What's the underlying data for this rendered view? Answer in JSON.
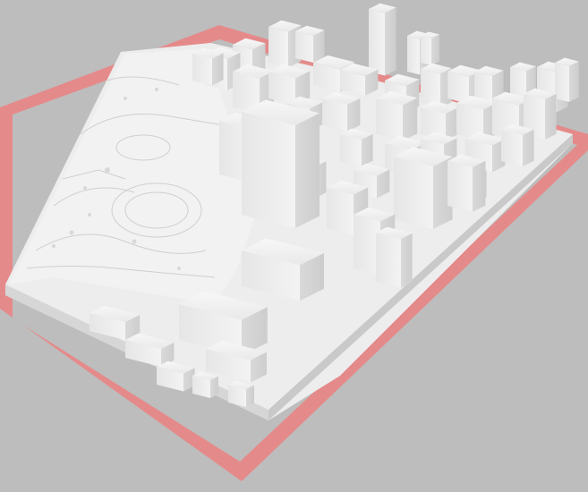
{
  "viewport": {
    "background_color": "#bdbdbd",
    "plate_border_color": "#e58a8a",
    "model_color": "#efefef",
    "model_shadow_color": "#cfcfcf",
    "model_dark_color": "#b9b9b9"
  },
  "scene": {
    "description_icon": "city-3d-model-icon"
  }
}
